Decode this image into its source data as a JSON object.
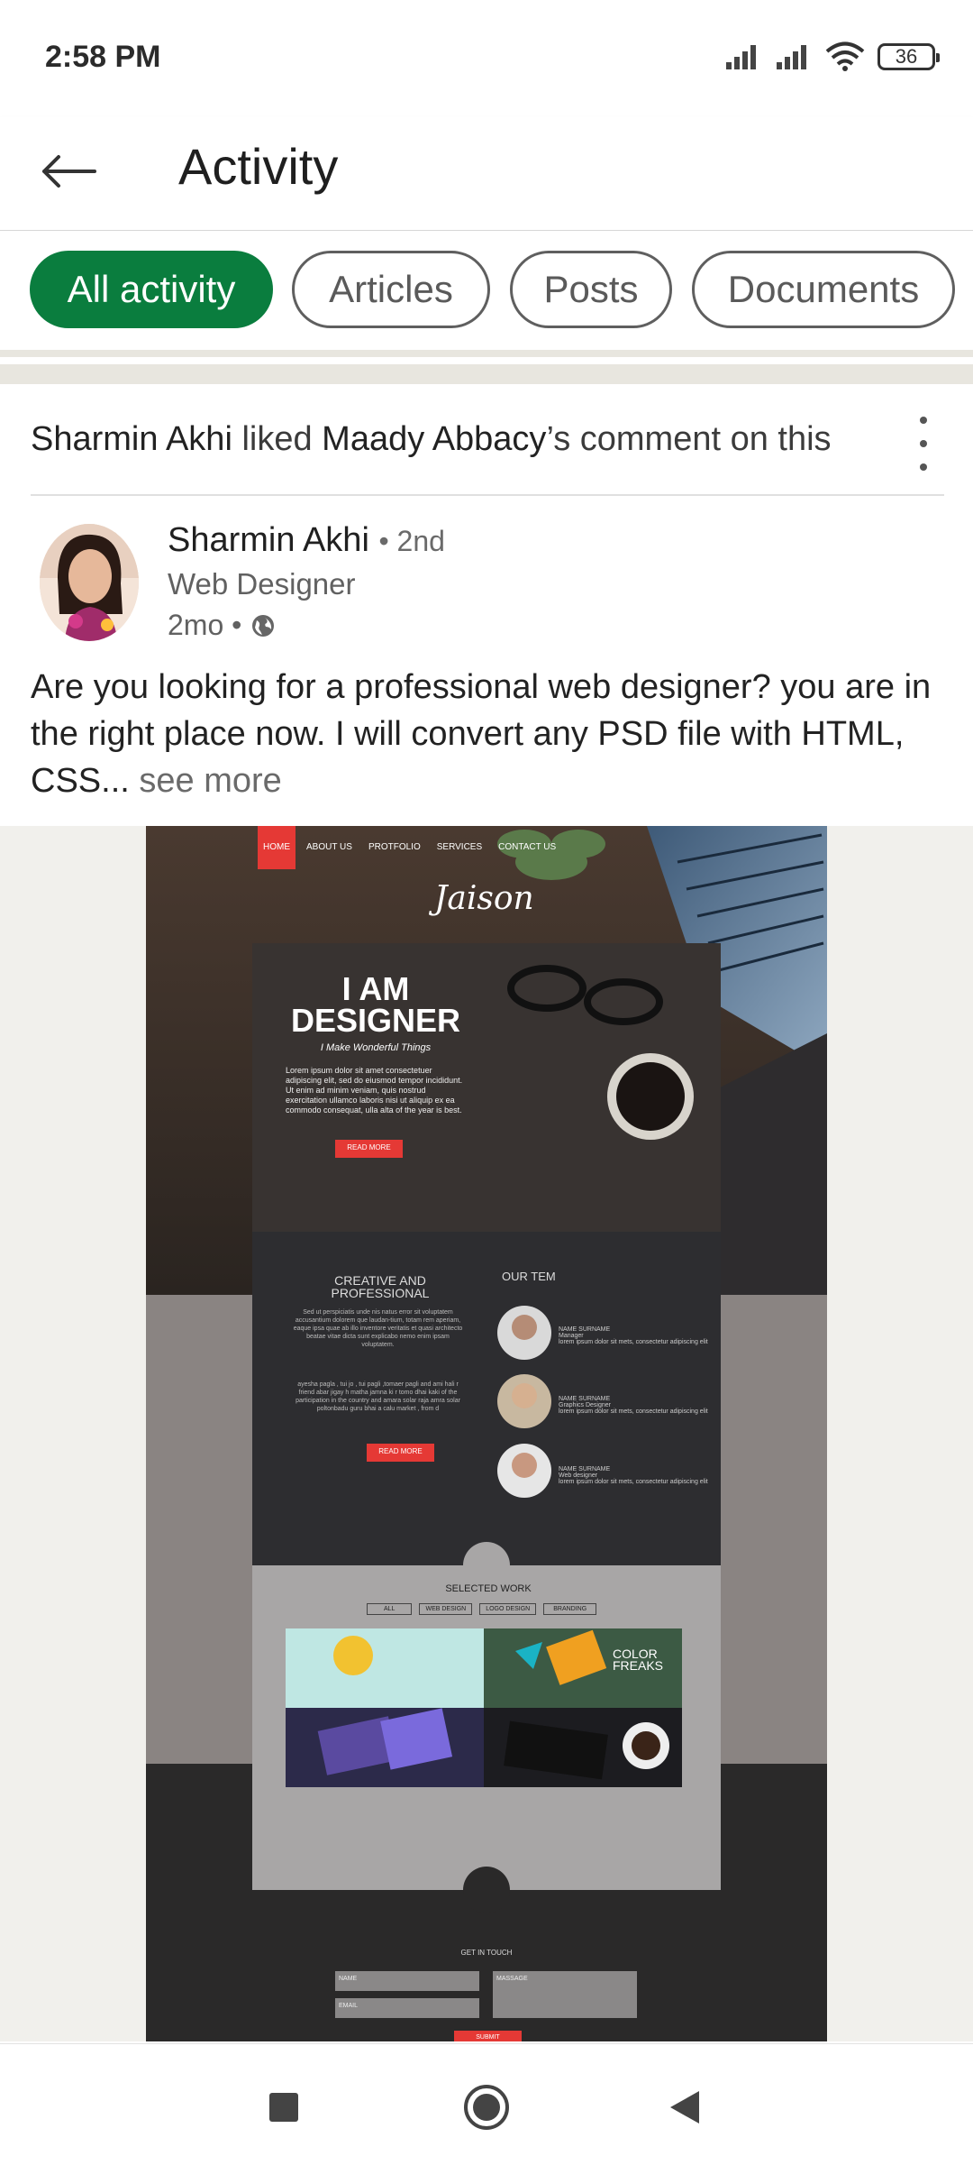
{
  "status_bar": {
    "time": "2:58 PM",
    "battery": "36"
  },
  "app_bar": {
    "title": "Activity"
  },
  "tabs": [
    {
      "label": "All activity",
      "active": true
    },
    {
      "label": "Articles",
      "active": false
    },
    {
      "label": "Posts",
      "active": false
    },
    {
      "label": "Documents",
      "active": false
    }
  ],
  "activity": {
    "actor": "Sharmin Akhi",
    "action": "liked",
    "target": "Maady Abbacy",
    "suffix": "’s comment on this"
  },
  "post": {
    "author": "Sharmin Akhi",
    "degree": "• 2nd",
    "headline": "Web Designer",
    "time": "2mo •",
    "text": "Are you looking for a professional web designer? you are in the right place now. I will convert any PSD file with HTML, CSS...",
    "see_more": "see more"
  },
  "mockup": {
    "nav": [
      "HOME",
      "ABOUT US",
      "PROTFOLIO",
      "SERVICES",
      "CONTACT US"
    ],
    "logo": "Jaison",
    "hero_title_1": "I AM",
    "hero_title_2": "DESIGNER",
    "hero_tagline": "I Make Wonderful Things",
    "hero_body": "Lorem ipsum dolor sit amet consectetuer adipiscing elit, sed do eiusmod tempor incididunt. Ut enim ad minim veniam, quis nostrud exercitation ullamco laboris nisi ut aliquip ex ea commodo consequat, ulla alta of the year is best.",
    "read_more": "READ MORE",
    "creative_title": "CREATIVE AND PROFESSIONAL",
    "creative_body": "Sed ut perspiciatis unde nis natus error sit voluptatem accusantium dolorem que laudan-tium, totam rem aperiam, eaque ipsa quae ab illo inventore veritatis et quasi architecto beatae vitae dicta sunt explicabo nemo enim ipsam voluptatem.",
    "creative_body_2": "ayesha pagla , tui jo , tui pagli ,tomaer pagli and ami hali r friend abar jigay h matha jamna ki r tomo dhai kaki of the participation in the country and amara solar raja amra solar poltonbadu guru bhai a calu market , from d",
    "team_title": "OUR TEM",
    "team": [
      {
        "name": "NAME SURNAME",
        "role": "Manager",
        "desc": "lorem ipsum dolor sit mets, consectetur adipiscing elit"
      },
      {
        "name": "NAME SURNAME",
        "role": "Graphics Designer",
        "desc": "lorem ipsum dolor sit mets, consectetur adipiscing elit"
      },
      {
        "name": "NAME SURNAME",
        "role": "Web designer",
        "desc": "lorem ipsum dolor sit mets, consectetur adipiscing elit"
      }
    ],
    "selected_work": "SELECTED WORK",
    "filters": [
      "ALL",
      "WEB DESIGN",
      "LOGO DESIGN",
      "BRANDING"
    ],
    "color_freaks": "COLOR FREAKS",
    "get_in_touch": "GET IN TOUCH",
    "form_name": "NAME",
    "form_email": "EMAIL",
    "form_message": "MASSAGE",
    "submit": "SUBMIT"
  },
  "colors": {
    "accent_green": "#0a7d3e",
    "mock_red": "#e53935"
  }
}
